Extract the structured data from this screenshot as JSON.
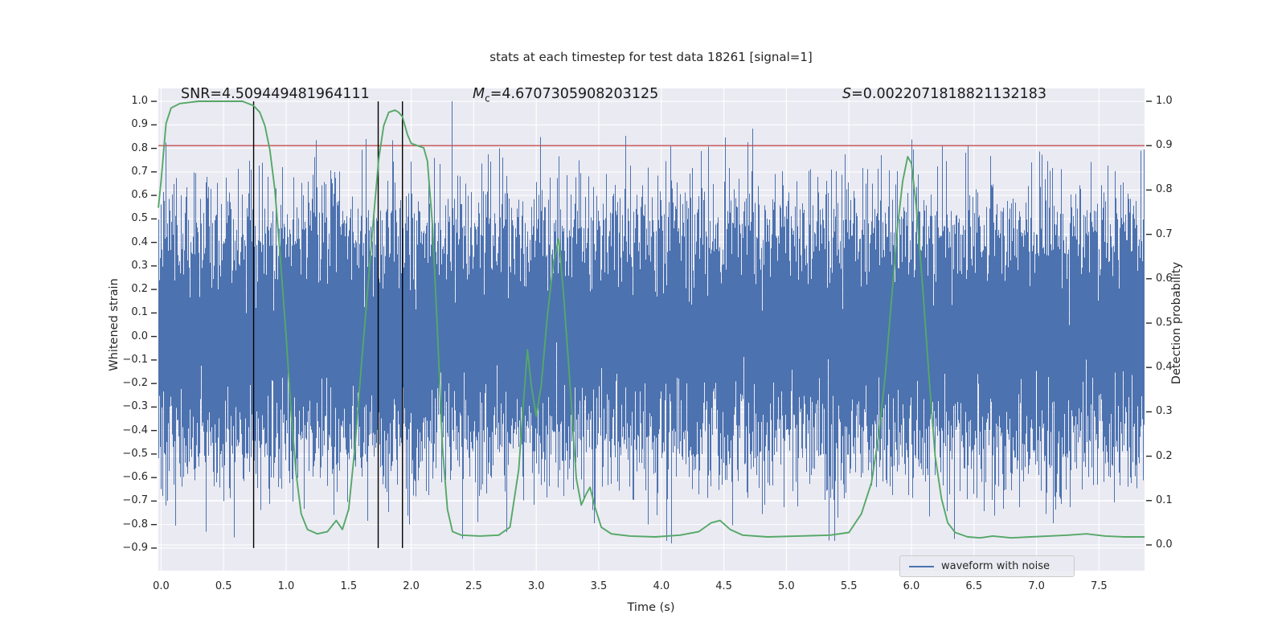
{
  "title": "stats at each timestep for test data 18261 [signal=1]",
  "annotations": {
    "snr_text": "SNR=4.509449481964111",
    "mc_prefix": "M",
    "mc_sub": "c",
    "mc_rest": "=4.6707305908203125",
    "s_prefix": "S",
    "s_rest": "=0.0022071818821132183"
  },
  "legend": {
    "label": "waveform with noise",
    "position": "lower right"
  },
  "chart_data": {
    "type": "line",
    "title": "stats at each timestep for test data 18261 [signal=1]",
    "xlabel": "Time (s)",
    "ylabel_left": "Whitened strain",
    "ylabel_right": "Detection probability",
    "grid": true,
    "x_ticks": [
      0.0,
      0.5,
      1.0,
      1.5,
      2.0,
      2.5,
      3.0,
      3.5,
      4.0,
      4.5,
      5.0,
      5.5,
      6.0,
      6.5,
      7.0,
      7.5
    ],
    "left_ticks": [
      1.0,
      0.9,
      0.8,
      0.7,
      0.6,
      0.5,
      0.4,
      0.3,
      0.2,
      0.1,
      0.0,
      -0.1,
      -0.2,
      -0.3,
      -0.4,
      -0.5,
      -0.6,
      -0.7,
      -0.8,
      -0.9
    ],
    "right_ticks": [
      1.0,
      0.9,
      0.8,
      0.7,
      0.6,
      0.5,
      0.4,
      0.3,
      0.2,
      0.1,
      0.0
    ],
    "xlim": [
      -0.022,
      7.864
    ],
    "ylim_left": [
      -0.996,
      1.055
    ],
    "ylim_right": [
      -0.058,
      1.029
    ],
    "stats": {
      "snr": 4.509449481964111,
      "chirp_mass": 4.6707305908203125,
      "s_value": 0.0022071818821132183,
      "signal": 1
    },
    "threshold": {
      "value_right_axis": 0.9,
      "color": "#c44e52"
    },
    "event_marker_times": [
      0.74,
      1.736,
      1.93
    ],
    "event_marker_color": "#000000",
    "event_marker_span_left_axis": [
      1.0,
      -0.9
    ],
    "series": [
      {
        "name": "waveform with noise",
        "axis": "left",
        "color": "#4c72b0",
        "representation": "gaussian_noise_envelope",
        "noise_sd": 0.28,
        "samples_per_column": 13,
        "seed": 18261,
        "clip": [
          -0.88,
          1.0
        ],
        "feature_spikes": [
          [
            0.36,
            -0.83
          ],
          [
            1.635,
            0.84
          ],
          [
            2.325,
            1.0
          ],
          [
            2.53,
            -0.79
          ],
          [
            2.7,
            0.8
          ],
          [
            5.38,
            -0.87
          ],
          [
            6.45,
            0.81
          ],
          [
            7.83,
            0.79
          ]
        ]
      },
      {
        "name": "detection probability",
        "axis": "right",
        "color": "#55a868",
        "points": [
          [
            -0.022,
            0.76
          ],
          [
            0.0,
            0.82
          ],
          [
            0.04,
            0.95
          ],
          [
            0.08,
            0.985
          ],
          [
            0.15,
            0.995
          ],
          [
            0.3,
            1.0
          ],
          [
            0.5,
            1.0
          ],
          [
            0.65,
            1.0
          ],
          [
            0.74,
            0.99
          ],
          [
            0.79,
            0.975
          ],
          [
            0.83,
            0.945
          ],
          [
            0.87,
            0.89
          ],
          [
            0.91,
            0.8
          ],
          [
            0.95,
            0.66
          ],
          [
            1.0,
            0.47
          ],
          [
            1.04,
            0.3
          ],
          [
            1.08,
            0.16
          ],
          [
            1.12,
            0.07
          ],
          [
            1.17,
            0.035
          ],
          [
            1.25,
            0.025
          ],
          [
            1.33,
            0.03
          ],
          [
            1.4,
            0.055
          ],
          [
            1.45,
            0.035
          ],
          [
            1.5,
            0.08
          ],
          [
            1.55,
            0.22
          ],
          [
            1.6,
            0.4
          ],
          [
            1.65,
            0.57
          ],
          [
            1.7,
            0.74
          ],
          [
            1.74,
            0.87
          ],
          [
            1.78,
            0.945
          ],
          [
            1.82,
            0.975
          ],
          [
            1.87,
            0.98
          ],
          [
            1.9,
            0.975
          ],
          [
            1.93,
            0.965
          ],
          [
            1.97,
            0.925
          ],
          [
            2.0,
            0.905
          ],
          [
            2.05,
            0.9
          ],
          [
            2.1,
            0.895
          ],
          [
            2.13,
            0.865
          ],
          [
            2.17,
            0.72
          ],
          [
            2.21,
            0.48
          ],
          [
            2.25,
            0.22
          ],
          [
            2.29,
            0.08
          ],
          [
            2.33,
            0.03
          ],
          [
            2.4,
            0.022
          ],
          [
            2.55,
            0.02
          ],
          [
            2.7,
            0.022
          ],
          [
            2.79,
            0.04
          ],
          [
            2.86,
            0.17
          ],
          [
            2.9,
            0.33
          ],
          [
            2.93,
            0.44
          ],
          [
            2.96,
            0.36
          ],
          [
            3.0,
            0.29
          ],
          [
            3.04,
            0.36
          ],
          [
            3.09,
            0.52
          ],
          [
            3.14,
            0.64
          ],
          [
            3.18,
            0.69
          ],
          [
            3.22,
            0.56
          ],
          [
            3.26,
            0.4
          ],
          [
            3.29,
            0.28
          ],
          [
            3.32,
            0.15
          ],
          [
            3.36,
            0.09
          ],
          [
            3.4,
            0.115
          ],
          [
            3.43,
            0.13
          ],
          [
            3.47,
            0.085
          ],
          [
            3.52,
            0.04
          ],
          [
            3.6,
            0.025
          ],
          [
            3.75,
            0.02
          ],
          [
            3.95,
            0.018
          ],
          [
            4.15,
            0.022
          ],
          [
            4.3,
            0.03
          ],
          [
            4.4,
            0.05
          ],
          [
            4.47,
            0.055
          ],
          [
            4.55,
            0.035
          ],
          [
            4.65,
            0.022
          ],
          [
            4.85,
            0.018
          ],
          [
            5.1,
            0.02
          ],
          [
            5.35,
            0.022
          ],
          [
            5.5,
            0.028
          ],
          [
            5.6,
            0.07
          ],
          [
            5.68,
            0.14
          ],
          [
            5.74,
            0.25
          ],
          [
            5.79,
            0.38
          ],
          [
            5.84,
            0.55
          ],
          [
            5.89,
            0.72
          ],
          [
            5.93,
            0.82
          ],
          [
            5.97,
            0.875
          ],
          [
            6.0,
            0.86
          ],
          [
            6.04,
            0.76
          ],
          [
            6.09,
            0.58
          ],
          [
            6.14,
            0.38
          ],
          [
            6.19,
            0.2
          ],
          [
            6.24,
            0.105
          ],
          [
            6.29,
            0.05
          ],
          [
            6.35,
            0.028
          ],
          [
            6.45,
            0.018
          ],
          [
            6.55,
            0.016
          ],
          [
            6.65,
            0.02
          ],
          [
            6.8,
            0.016
          ],
          [
            6.95,
            0.018
          ],
          [
            7.1,
            0.02
          ],
          [
            7.25,
            0.022
          ],
          [
            7.4,
            0.025
          ],
          [
            7.55,
            0.02
          ],
          [
            7.7,
            0.018
          ],
          [
            7.864,
            0.018
          ]
        ]
      }
    ],
    "colors": {
      "axes_background": "#eaeaf2",
      "gridline": "#ffffff",
      "waveform": "#4c72b0",
      "probability": "#55a868",
      "threshold": "#c44e52",
      "text": "#262626"
    }
  }
}
